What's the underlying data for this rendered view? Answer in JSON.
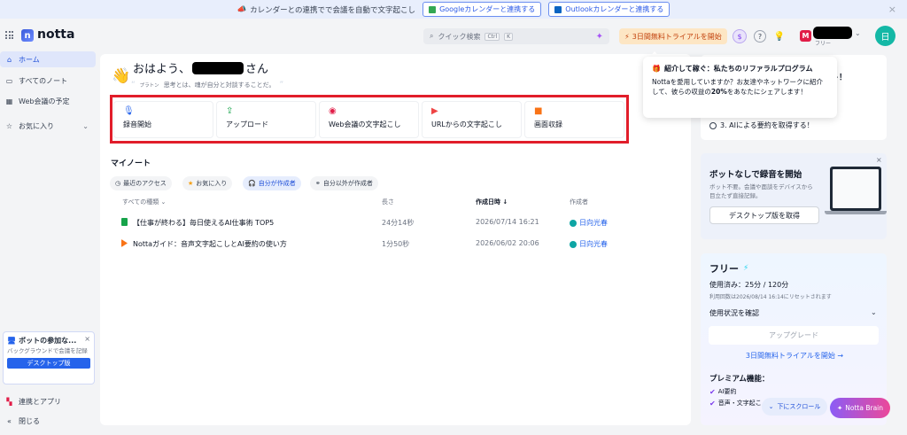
{
  "banner": {
    "text": "カレンダーとの連携でで会議を自動で文字起こし",
    "google_btn": "Googleカレンダーと連携する",
    "outlook_btn": "Outlookカレンダーと連携する",
    "close": "×"
  },
  "header": {
    "logo": "notta",
    "search_placeholder": "クイック検索",
    "search_key1": "Ctrl",
    "search_key2": "K",
    "trial_btn": "3日間無料トライアルを開始",
    "plan_label": "フリー",
    "avatar_m": "M",
    "avatar_user": "日"
  },
  "sidebar": {
    "items": [
      {
        "label": "ホーム",
        "icon": "home-icon"
      },
      {
        "label": "すべてのノート",
        "icon": "notes-icon"
      },
      {
        "label": "Web会議の予定",
        "icon": "calendar-icon"
      },
      {
        "label": "お気に入り",
        "icon": "star-icon"
      }
    ],
    "bot_promo": {
      "title": "ボットの参加な...",
      "desc": "バックグラウンドで会議を記録",
      "button": "デスクトップ版"
    },
    "integrations": "連携とアプリ",
    "collapse": "閉じる"
  },
  "greeting": {
    "prefix": "おはよう、",
    "suffix": "さん",
    "quote": "思考とは、魂が自分と対談することだ。",
    "quote_author": "プラトン"
  },
  "actions": [
    {
      "label": "録音開始",
      "icon": "mic-icon",
      "color": "#2563eb"
    },
    {
      "label": "アップロード",
      "icon": "upload-icon",
      "color": "#16a34a"
    },
    {
      "label": "Web会議の文字起こし",
      "icon": "meeting-icon",
      "color": "#e11d48"
    },
    {
      "label": "URLからの文字起こし",
      "icon": "youtube-icon",
      "color": "#ef4444"
    },
    {
      "label": "画面収録",
      "icon": "screen-record-icon",
      "color": "#f97316"
    }
  ],
  "my_notes": {
    "title": "マイノート",
    "filters": [
      "最近のアクセス",
      "お気に入り",
      "自分が作成者",
      "自分以外が作成者"
    ],
    "active_filter": "自分が作成者",
    "columns": [
      "すべての種類",
      "長さ",
      "作成日時 ↓",
      "作成者"
    ],
    "rows": [
      {
        "title": "【仕事が終わる】毎日使えるAI仕事術 TOP5",
        "length": "24分14秒",
        "created": "2026/07/14 16:21",
        "author": "日向光春",
        "type_color": "#16a34a"
      },
      {
        "title": "Nottaガイド：音声文字起こしとAI要約の使い方",
        "length": "1分50秒",
        "created": "2026/06/02 20:06",
        "author": "日向光春",
        "type_color": "#f97316"
      }
    ]
  },
  "right_panel": {
    "card1_title_fragment": "ット！",
    "step3": "3. AIによる要約を取得する！",
    "tooltip_title": "紹介して稼ぐ：私たちのリファラルプログラム",
    "tooltip_body_1": "Nottaを愛用していますか？お友達やネットワークに紹介して、彼らの収益の",
    "tooltip_body_bold": "20%",
    "tooltip_body_2": "をあなたにシェアします！",
    "botless_title": "ボットなしで録音を開始",
    "botless_desc": "ボット不要。会議や面談をデバイスから目立たず直接記録。",
    "botless_btn": "デスクトップ版を取得",
    "plan_title": "フリー",
    "usage": "使用済み：25分 / 120分",
    "reset": "利用回数は2026/08/14 16:14にリセットされます",
    "usage_link": "使用状況を確認",
    "upgrade": "アップグレード",
    "trial_link": "3日間無料トライアルを開始 →",
    "premium_title": "プレミアム機能：",
    "features": [
      "AI要約",
      "音声・文字起こ"
    ]
  },
  "floating": {
    "scroll_down": "下にスクロール",
    "brain": "Notta Brain"
  }
}
